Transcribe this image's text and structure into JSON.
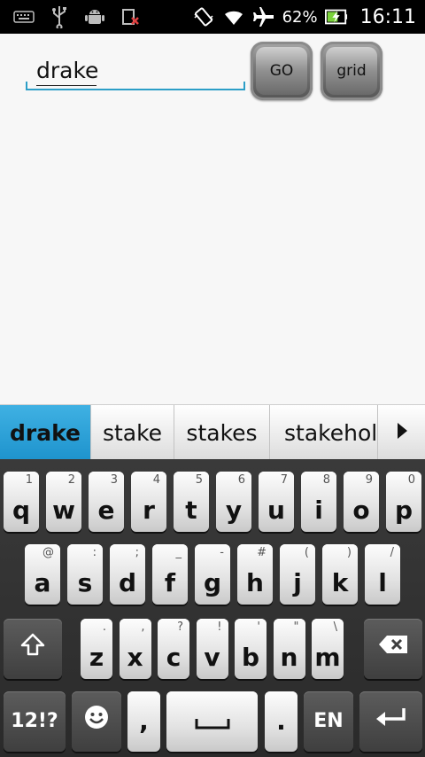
{
  "status_bar": {
    "left_icons": [
      "keyboard-icon",
      "usb-icon",
      "android-icon",
      "no-signal-icon"
    ],
    "right_icons": [
      "vibrate-icon",
      "wifi-icon",
      "airplane-icon"
    ],
    "battery_percent": "62%",
    "battery_level": 0.62,
    "time": "16:11"
  },
  "search": {
    "value": "drake",
    "go_label": "GO",
    "grid_label": "grid"
  },
  "suggestions": [
    "drake",
    "stake",
    "stakes",
    "stakeholc"
  ],
  "keyboard": {
    "row1": [
      {
        "main": "q",
        "alt": "1"
      },
      {
        "main": "w",
        "alt": "2"
      },
      {
        "main": "e",
        "alt": "3"
      },
      {
        "main": "r",
        "alt": "4"
      },
      {
        "main": "t",
        "alt": "5"
      },
      {
        "main": "y",
        "alt": "6"
      },
      {
        "main": "u",
        "alt": "7"
      },
      {
        "main": "i",
        "alt": "8"
      },
      {
        "main": "o",
        "alt": "9"
      },
      {
        "main": "p",
        "alt": "0"
      }
    ],
    "row2": [
      {
        "main": "a",
        "alt": "@"
      },
      {
        "main": "s",
        "alt": ":"
      },
      {
        "main": "d",
        "alt": ";"
      },
      {
        "main": "f",
        "alt": "_"
      },
      {
        "main": "g",
        "alt": "-"
      },
      {
        "main": "h",
        "alt": "#"
      },
      {
        "main": "j",
        "alt": "("
      },
      {
        "main": "k",
        "alt": ")"
      },
      {
        "main": "l",
        "alt": "/"
      }
    ],
    "row3": [
      {
        "main": "z",
        "alt": "."
      },
      {
        "main": "x",
        "alt": ","
      },
      {
        "main": "c",
        "alt": "?"
      },
      {
        "main": "v",
        "alt": "!"
      },
      {
        "main": "b",
        "alt": "'"
      },
      {
        "main": "n",
        "alt": "\""
      },
      {
        "main": "m",
        "alt": "\\"
      }
    ],
    "symbols_label": "12!?",
    "comma_label": ",",
    "period_label": ".",
    "lang_label": "EN"
  },
  "colors": {
    "accent": "#2c9ec7",
    "suggestion_selected": "#2aa3dc"
  }
}
